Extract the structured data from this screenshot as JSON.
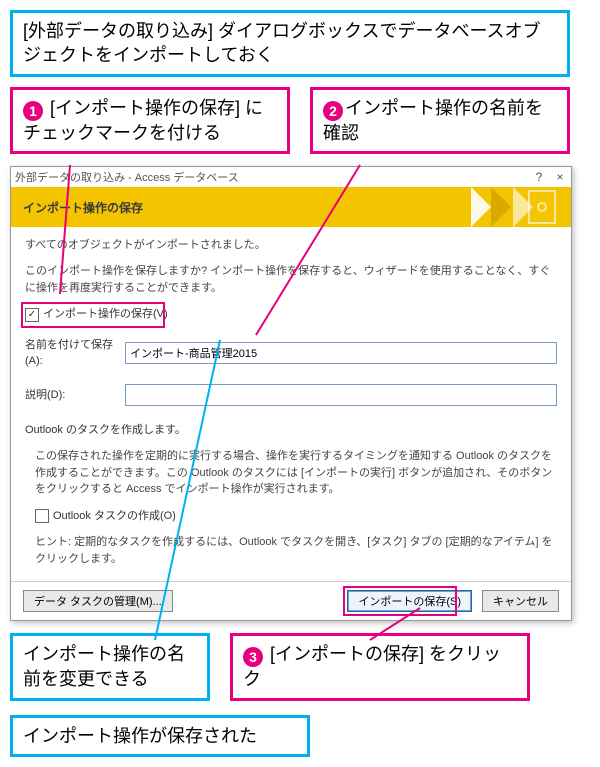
{
  "callouts": {
    "top": "[外部データの取り込み] ダイアログボックスでデータベースオブジェクトをインポートしておく",
    "step1": " [インポート操作の保存] にチェックマークを付ける",
    "step2": "インポート操作の名前を確認",
    "rename_note": "インポート操作の名前を変更できる",
    "step3": " [インポートの保存] をクリック",
    "bottom": "インポート操作が保存された",
    "num1": "❶",
    "num2": "❷",
    "num3": "❸"
  },
  "dialog": {
    "title": "外部データの取り込み - Access データベース",
    "help_icon": "?",
    "close_icon": "×",
    "banner": "インポート操作の保存",
    "line_all_imported": "すべてのオブジェクトがインポートされました。",
    "line_save_q": "このインポート操作を保存しますか? インポート操作を保存すると、ウィザードを使用することなく、すぐに操作を再度実行することができます。",
    "chk_save_label": "インポート操作の保存(V)",
    "chk_save_checked": "✓",
    "name_label": "名前を付けて保存(A):",
    "name_value": "インポート-商品管理2015",
    "desc_label": "説明(D):",
    "desc_value": "",
    "outlook_header": "Outlook のタスクを作成します。",
    "outlook_body": "この保存された操作を定期的に実行する場合、操作を実行するタイミングを通知する Outlook のタスクを作成することができます。この Outlook のタスクには [インポートの実行] ボタンが追加され、そのボタンをクリックすると Access でインポート操作が実行されます。",
    "chk_outlook_label": "Outlook タスクの作成(O)",
    "hint": "ヒント: 定期的なタスクを作成するには、Outlook でタスクを開き、[タスク] タブの [定期的なアイテム] をクリックします。",
    "btn_manage": "データ タスクの管理(M)...",
    "btn_save": "インポートの保存(S)",
    "btn_cancel": "キャンセル"
  },
  "colors": {
    "cyan": "#00b0f0",
    "magenta": "#e6007e",
    "banner": "#f5c400"
  }
}
